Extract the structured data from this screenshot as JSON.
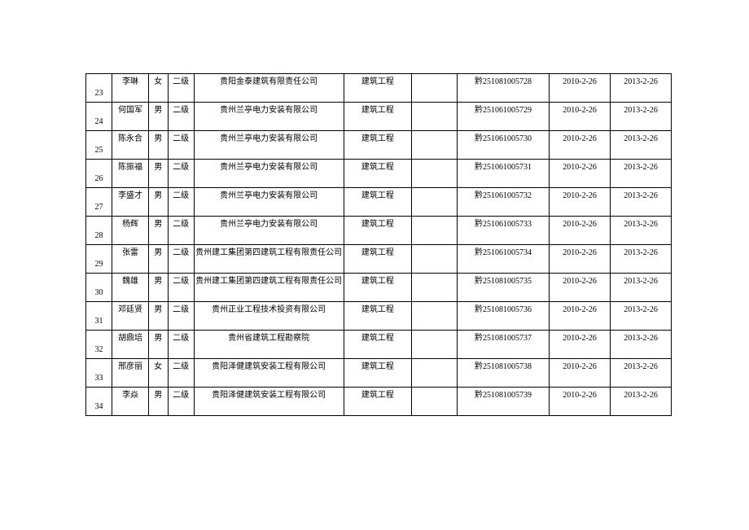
{
  "table": {
    "rows": [
      {
        "num": "23",
        "name": "李琳",
        "gender": "女",
        "level": "二级",
        "company": "贵阳金泰建筑有限责任公司",
        "category": "建筑工程",
        "empty": "",
        "certNo": "黔251081005728",
        "date1": "2010-2-26",
        "date2": "2013-2-26"
      },
      {
        "num": "24",
        "name": "何国军",
        "gender": "男",
        "level": "二级",
        "company": "贵州兰亭电力安装有限公司",
        "category": "建筑工程",
        "empty": "",
        "certNo": "黔251061005729",
        "date1": "2010-2-26",
        "date2": "2013-2-26"
      },
      {
        "num": "25",
        "name": "陈永合",
        "gender": "男",
        "level": "二级",
        "company": "贵州兰亭电力安装有限公司",
        "category": "建筑工程",
        "empty": "",
        "certNo": "黔251061005730",
        "date1": "2010-2-26",
        "date2": "2013-2-26"
      },
      {
        "num": "26",
        "name": "陈振福",
        "gender": "男",
        "level": "二级",
        "company": "贵州兰亭电力安装有限公司",
        "category": "建筑工程",
        "empty": "",
        "certNo": "黔251061005731",
        "date1": "2010-2-26",
        "date2": "2013-2-26"
      },
      {
        "num": "27",
        "name": "李盛才",
        "gender": "男",
        "level": "二级",
        "company": "贵州兰亭电力安装有限公司",
        "category": "建筑工程",
        "empty": "",
        "certNo": "黔251061005732",
        "date1": "2010-2-26",
        "date2": "2013-2-26"
      },
      {
        "num": "28",
        "name": "杨辉",
        "gender": "男",
        "level": "二级",
        "company": "贵州兰亭电力安装有限公司",
        "category": "建筑工程",
        "empty": "",
        "certNo": "黔251061005733",
        "date1": "2010-2-26",
        "date2": "2013-2-26"
      },
      {
        "num": "29",
        "name": "张雷",
        "gender": "男",
        "level": "二级",
        "company": "贵州建工集团第四建筑工程有限责任公司",
        "category": "建筑工程",
        "empty": "",
        "certNo": "黔251061005734",
        "date1": "2010-2-26",
        "date2": "2013-2-26"
      },
      {
        "num": "30",
        "name": "魏雄",
        "gender": "男",
        "level": "二级",
        "company": "贵州建工集团第四建筑工程有限责任公司",
        "category": "建筑工程",
        "empty": "",
        "certNo": "黔251081005735",
        "date1": "2010-2-26",
        "date2": "2013-2-26"
      },
      {
        "num": "31",
        "name": "邓廷贤",
        "gender": "男",
        "level": "二级",
        "company": "贵州正业工程技术投资有限公司",
        "category": "建筑工程",
        "empty": "",
        "certNo": "黔251081005736",
        "date1": "2010-2-26",
        "date2": "2013-2-26"
      },
      {
        "num": "32",
        "name": "胡鼎培",
        "gender": "男",
        "level": "二级",
        "company": "贵州省建筑工程勘察院",
        "category": "建筑工程",
        "empty": "",
        "certNo": "黔251081005737",
        "date1": "2010-2-26",
        "date2": "2013-2-26"
      },
      {
        "num": "33",
        "name": "邢彦丽",
        "gender": "女",
        "level": "二级",
        "company": "贵阳泽健建筑安装工程有限公司",
        "category": "建筑工程",
        "empty": "",
        "certNo": "黔251081005738",
        "date1": "2010-2-26",
        "date2": "2013-2-26"
      },
      {
        "num": "34",
        "name": "李焱",
        "gender": "男",
        "level": "二级",
        "company": "贵阳泽健建筑安装工程有限公司",
        "category": "建筑工程",
        "empty": "",
        "certNo": "黔251081005739",
        "date1": "2010-2-26",
        "date2": "2013-2-26"
      }
    ]
  }
}
